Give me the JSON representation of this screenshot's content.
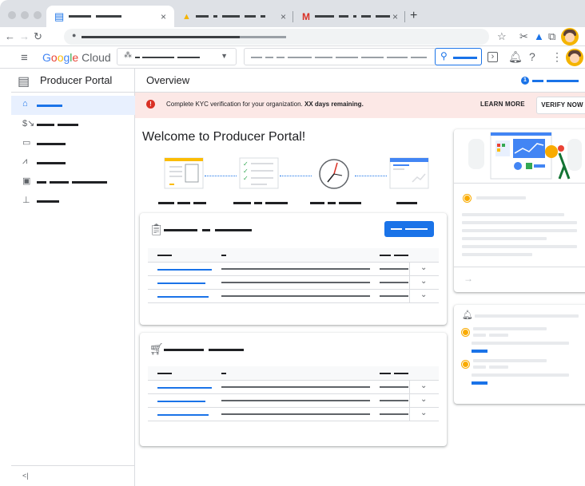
{
  "browser": {
    "tabs": [
      {
        "icon": "producer-portal-icon",
        "active": true
      },
      {
        "icon": "google-drive-icon",
        "active": false
      },
      {
        "icon": "gmail-icon",
        "active": false
      }
    ],
    "close_glyph": "×",
    "new_tab_glyph": "+"
  },
  "header": {
    "logo_text": "Google Cloud",
    "avatar_color": "#f4b400"
  },
  "sidebar": {
    "title": "Producer Portal",
    "collapse_glyph": "<|"
  },
  "main": {
    "page_title": "Overview",
    "notification_count": "1",
    "banner": {
      "message_prefix": "Complete KYC verification for your organization.",
      "message_bold": "XX days remaining.",
      "learn_more": "LEARN MORE",
      "verify_now": "VERIFY NOW"
    },
    "welcome": "Welcome to Producer Portal!"
  },
  "colors": {
    "accent": "#1a73e8",
    "error": "#d93025",
    "banner_bg": "#fce8e6",
    "warning": "#f9ab00"
  }
}
